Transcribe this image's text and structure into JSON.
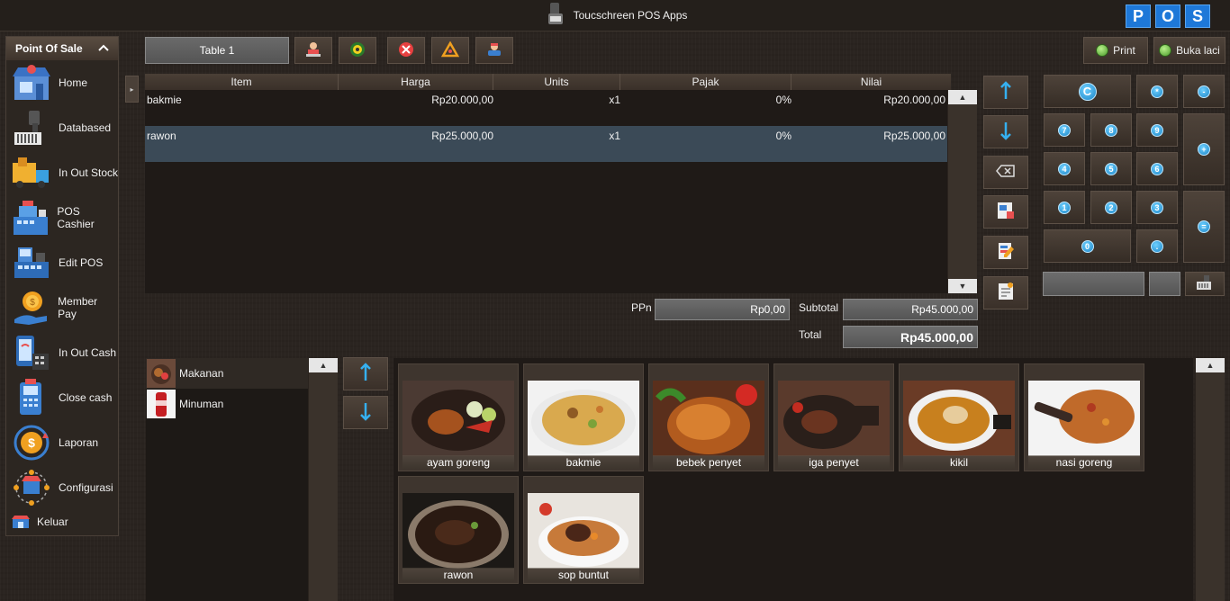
{
  "window": {
    "title": "Toucschreen POS Apps",
    "logo_letters": [
      "P",
      "O",
      "S"
    ]
  },
  "sidebar": {
    "header": "Point Of Sale",
    "items": [
      {
        "label": "Home",
        "icon": "store-icon"
      },
      {
        "label": "Databased",
        "icon": "barcode-scanner-icon"
      },
      {
        "label": "In Out Stock",
        "icon": "delivery-truck-icon"
      },
      {
        "label": "POS Cashier",
        "icon": "cash-register-icon"
      },
      {
        "label": "Edit POS",
        "icon": "pos-terminal-icon"
      },
      {
        "label": "Member Pay",
        "icon": "coin-hand-icon"
      },
      {
        "label": "In Out Cash",
        "icon": "mobile-payment-icon"
      },
      {
        "label": "Close cash",
        "icon": "pos-machine-icon"
      },
      {
        "label": "Laporan",
        "icon": "dollar-cycle-icon"
      },
      {
        "label": "Configurasi",
        "icon": "store-network-icon"
      },
      {
        "label": "Keluar",
        "icon": "exit-icon"
      }
    ]
  },
  "toolbar": {
    "table_value": "Table 1",
    "print_label": "Print",
    "drawer_label": "Buka laci"
  },
  "grid": {
    "columns": [
      "Item",
      "Harga",
      "Units",
      "Pajak",
      "Nilai"
    ],
    "rows": [
      {
        "item": "bakmie",
        "harga": "Rp20.000,00",
        "units": "x1",
        "pajak": "0%",
        "nilai": "Rp20.000,00"
      },
      {
        "item": "rawon",
        "harga": "Rp25.000,00",
        "units": "x1",
        "pajak": "0%",
        "nilai": "Rp25.000,00"
      }
    ]
  },
  "totals": {
    "ppn_label": "PPn",
    "ppn_value": "Rp0,00",
    "subtotal_label": "Subtotal",
    "subtotal_value": "Rp45.000,00",
    "total_label": "Total",
    "total_value": "Rp45.000,00"
  },
  "keypad": {
    "clear": "C",
    "multiply": "*",
    "minus": "-",
    "plus": "+",
    "equals": "=",
    "dot": ".",
    "digits": [
      "7",
      "8",
      "9",
      "4",
      "5",
      "6",
      "1",
      "2",
      "3",
      "0"
    ]
  },
  "categories": [
    {
      "label": "Makanan"
    },
    {
      "label": "Minuman"
    }
  ],
  "products": [
    {
      "name": "ayam goreng"
    },
    {
      "name": "bakmie"
    },
    {
      "name": "bebek penyet"
    },
    {
      "name": "iga penyet"
    },
    {
      "name": "kikil"
    },
    {
      "name": "nasi goreng"
    },
    {
      "name": "rawon"
    },
    {
      "name": "sop buntut"
    }
  ]
}
